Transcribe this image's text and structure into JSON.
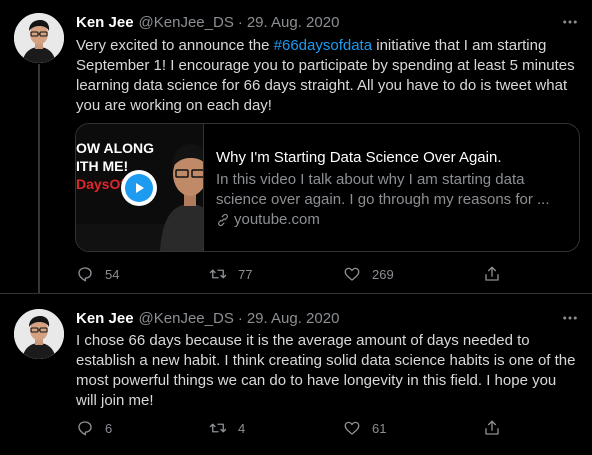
{
  "colors": {
    "background": "#000000",
    "link": "#1d9bf0",
    "muted": "#8b8f93",
    "text": "#d9d9d9"
  },
  "tweets": [
    {
      "name": "Ken Jee",
      "handle": "@KenJee_DS",
      "separator": "·",
      "date": "29. Aug. 2020",
      "text_before": "Very excited to announce the ",
      "hashtag": "#66daysofdata",
      "text_after": " initiative that I am starting September 1! I encourage you to participate by spending at least 5 minutes learning data science for 66 days straight. All you have to do is tweet what you are working on each day!",
      "card": {
        "thumb_line1": "OW ALONG",
        "thumb_line2": "ITH ME!",
        "thumb_line3": "DaysOfData",
        "title": "Why I'm Starting Data Science Over Again.",
        "description": "In this video I talk about why I am starting data science over again. I go through my reasons for ...",
        "domain": "youtube.com"
      },
      "replies": "54",
      "retweets": "77",
      "likes": "269"
    },
    {
      "name": "Ken Jee",
      "handle": "@KenJee_DS",
      "separator": "·",
      "date": "29. Aug. 2020",
      "text": "I chose 66 days because it is the average amount of days needed to establish a new habit. I think creating solid data science habits is one of the most powerful things we can do to have longevity in this field. I hope you will join me!",
      "replies": "6",
      "retweets": "4",
      "likes": "61"
    }
  ],
  "icons": [
    "more-icon",
    "reply-icon",
    "retweet-icon",
    "like-icon",
    "share-icon",
    "play-icon",
    "link-icon"
  ]
}
